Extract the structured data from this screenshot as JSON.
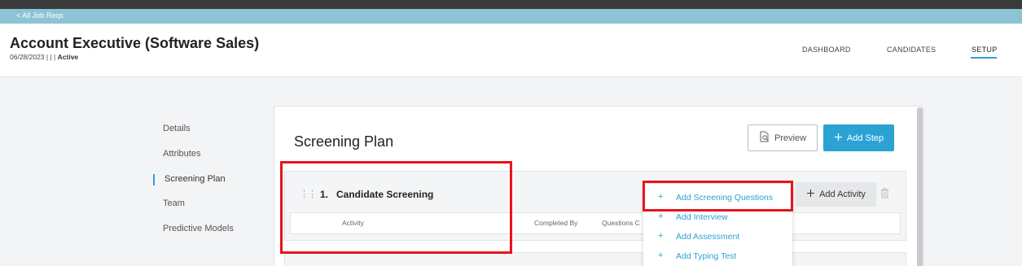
{
  "breadcrumb": {
    "back_label": "< All Job Reqs"
  },
  "job": {
    "title": "Account Executive (Software Sales)",
    "meta_prefix": "06/28/2023 | | |",
    "status": "Active"
  },
  "top_nav": {
    "dashboard": "DASHBOARD",
    "candidates": "CANDIDATES",
    "setup": "SETUP"
  },
  "side_nav": {
    "items": [
      "Details",
      "Attributes",
      "Screening Plan",
      "Team",
      "Predictive Models"
    ],
    "active": "Screening Plan"
  },
  "screening_plan": {
    "title": "Screening Plan",
    "preview_label": "Preview",
    "add_step_label": "Add Step",
    "step": {
      "number": "1.",
      "name": "Candidate Screening",
      "add_activity_label": "Add Activity",
      "columns": [
        "Activity",
        "Completed By",
        "Questions C"
      ]
    }
  },
  "add_activity_menu": {
    "items": [
      "Add Screening Questions",
      "Add Interview",
      "Add Assessment",
      "Add Typing Test"
    ]
  },
  "colors": {
    "accent": "#2aa3d4",
    "highlight": "#e8141b",
    "topbar": "#3a3a3a",
    "crumbbar": "#8cc4d6"
  },
  "icons": {
    "drag": "drag-handle-icon",
    "preview": "document-search-icon",
    "plus": "plus-icon",
    "trash": "trash-icon"
  }
}
